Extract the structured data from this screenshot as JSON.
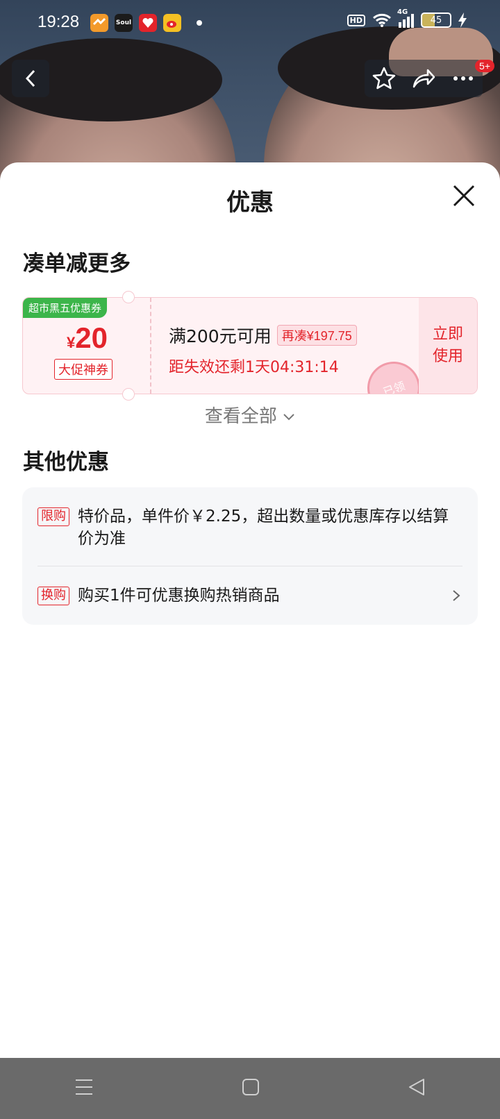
{
  "status_bar": {
    "time": "19:28",
    "apps": [
      {
        "name": "huawei-health-icon",
        "label": "",
        "color": "#f39a2b"
      },
      {
        "name": "soul-app-icon",
        "label": "Soul",
        "color": "#1b1b1b"
      },
      {
        "name": "app-red-icon",
        "label": "",
        "color": "#e3242b"
      },
      {
        "name": "weibo-icon",
        "label": "",
        "color": "#f5c023"
      }
    ],
    "hd": "HD",
    "signal": "4G",
    "battery": "45"
  },
  "top_bar": {
    "message_badge": "5+"
  },
  "sheet": {
    "title": "优惠",
    "section1_title": "凑单减更多",
    "coupon": {
      "tag": "超市黑五优惠券",
      "currency": "¥",
      "amount": "20",
      "type": "大促神券",
      "condition": "满200元可用",
      "more_needed": "再凑¥197.75",
      "expire": "距失效还剩1天04:31:14",
      "use_line1": "立即",
      "use_line2": "使用",
      "stamp": "已领"
    },
    "view_all": "查看全部",
    "section2_title": "其他优惠",
    "offers": [
      {
        "tag": "限购",
        "text": "特价品，单件价￥2.25，超出数量或优惠库存以结算价为准"
      },
      {
        "tag": "换购",
        "text": "购买1件可优惠换购热销商品"
      }
    ]
  },
  "colors": {
    "accent": "#e3242b",
    "tag_green": "#3cb54a",
    "coupon_bg": "#fff2f4"
  }
}
